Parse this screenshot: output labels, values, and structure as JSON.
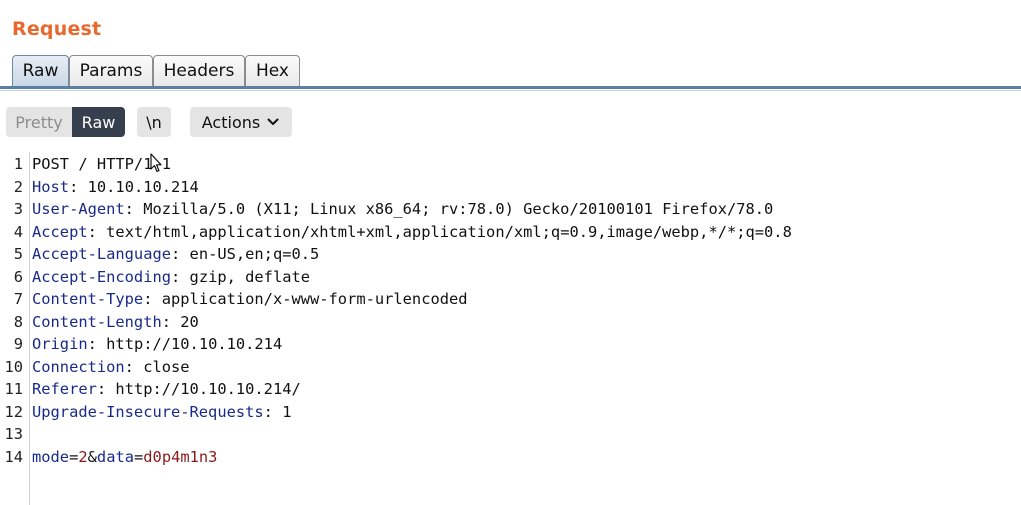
{
  "panel": {
    "title": "Request"
  },
  "tabs": [
    {
      "label": "Raw",
      "active": true
    },
    {
      "label": "Params",
      "active": false
    },
    {
      "label": "Headers",
      "active": false
    },
    {
      "label": "Hex",
      "active": false
    }
  ],
  "toolbar": {
    "pretty_label": "Pretty",
    "raw_label": "Raw",
    "newline_label": "\\n",
    "actions_label": "Actions"
  },
  "colors": {
    "title": "#e8692e",
    "header_name": "#1a2a8a",
    "param_value": "#8a1a1a",
    "raw_active_bg": "#353f4d"
  },
  "request": {
    "lines": [
      {
        "num": "1",
        "text": "POST / HTTP/1.1"
      },
      {
        "num": "2",
        "key": "Host",
        "sep": ": ",
        "value": "10.10.10.214"
      },
      {
        "num": "3",
        "key": "User-Agent",
        "sep": ": ",
        "value": "Mozilla/5.0 (X11; Linux x86_64; rv:78.0) Gecko/20100101 Firefox/78.0"
      },
      {
        "num": "4",
        "key": "Accept",
        "sep": ": ",
        "value": "text/html,application/xhtml+xml,application/xml;q=0.9,image/webp,*/*;q=0.8"
      },
      {
        "num": "5",
        "key": "Accept-Language",
        "sep": ": ",
        "value": "en-US,en;q=0.5"
      },
      {
        "num": "6",
        "key": "Accept-Encoding",
        "sep": ": ",
        "value": "gzip, deflate"
      },
      {
        "num": "7",
        "key": "Content-Type",
        "sep": ": ",
        "value": "application/x-www-form-urlencoded"
      },
      {
        "num": "8",
        "key": "Content-Length",
        "sep": ": ",
        "value": "20"
      },
      {
        "num": "9",
        "key": "Origin",
        "sep": ": ",
        "value": "http://10.10.10.214"
      },
      {
        "num": "10",
        "key": "Connection",
        "sep": ": ",
        "value": "close"
      },
      {
        "num": "11",
        "key": "Referer",
        "sep": ": ",
        "value": "http://10.10.10.214/"
      },
      {
        "num": "12",
        "key": "Upgrade-Insecure-Requests",
        "sep": ": ",
        "value": "1"
      },
      {
        "num": "13",
        "text": ""
      },
      {
        "num": "14",
        "params": [
          {
            "name": "mode",
            "eq": "=",
            "value": "2"
          },
          {
            "amp": "&"
          },
          {
            "name": "data",
            "eq": "=",
            "value": "d0p4m1n3"
          }
        ]
      }
    ]
  }
}
